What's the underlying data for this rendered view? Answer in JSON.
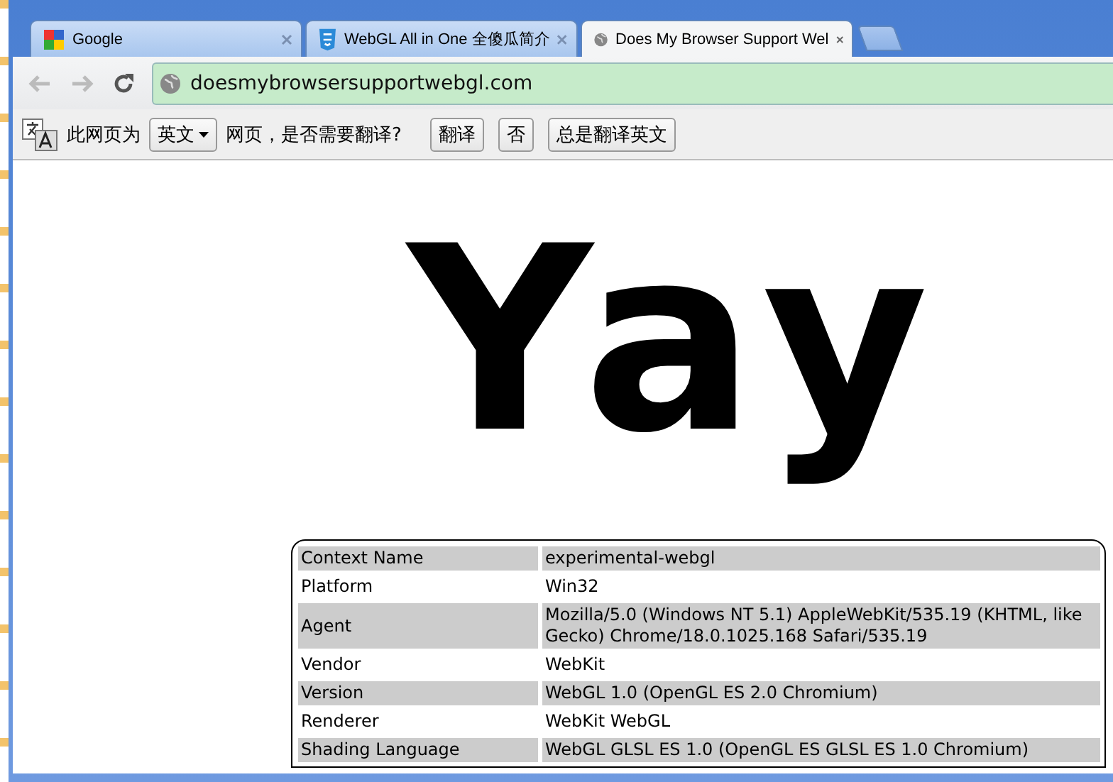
{
  "tabs": [
    {
      "title": "Google",
      "kind": "google",
      "selected": false
    },
    {
      "title": "WebGL All in One 全傻瓜简介",
      "kind": "html5",
      "selected": false
    },
    {
      "title": "Does My Browser Support Wel",
      "kind": "globe",
      "selected": true
    }
  ],
  "address_bar": {
    "url": "doesmybrowsersupportwebgl.com"
  },
  "translate_bar": {
    "prefix": "此网页为",
    "language": "英文",
    "suffix": "网页，是否需要翻译?",
    "buttons": [
      "翻译",
      "否",
      "总是翻译英文"
    ]
  },
  "page": {
    "headline": "Yay",
    "info_table": [
      {
        "name": "Context Name",
        "value": "experimental-webgl"
      },
      {
        "name": "Platform",
        "value": "Win32"
      },
      {
        "name": "Agent",
        "value": "Mozilla/5.0 (Windows NT 5.1) AppleWebKit/535.19 (KHTML, like Gecko) Chrome/18.0.1025.168 Safari/535.19"
      },
      {
        "name": "Vendor",
        "value": "WebKit"
      },
      {
        "name": "Version",
        "value": "WebGL 1.0 (OpenGL ES 2.0 Chromium)"
      },
      {
        "name": "Renderer",
        "value": "WebKit WebGL"
      },
      {
        "name": "Shading Language",
        "value": "WebGL GLSL ES 1.0 (OpenGL ES GLSL ES 1.0 Chromium)"
      }
    ]
  }
}
